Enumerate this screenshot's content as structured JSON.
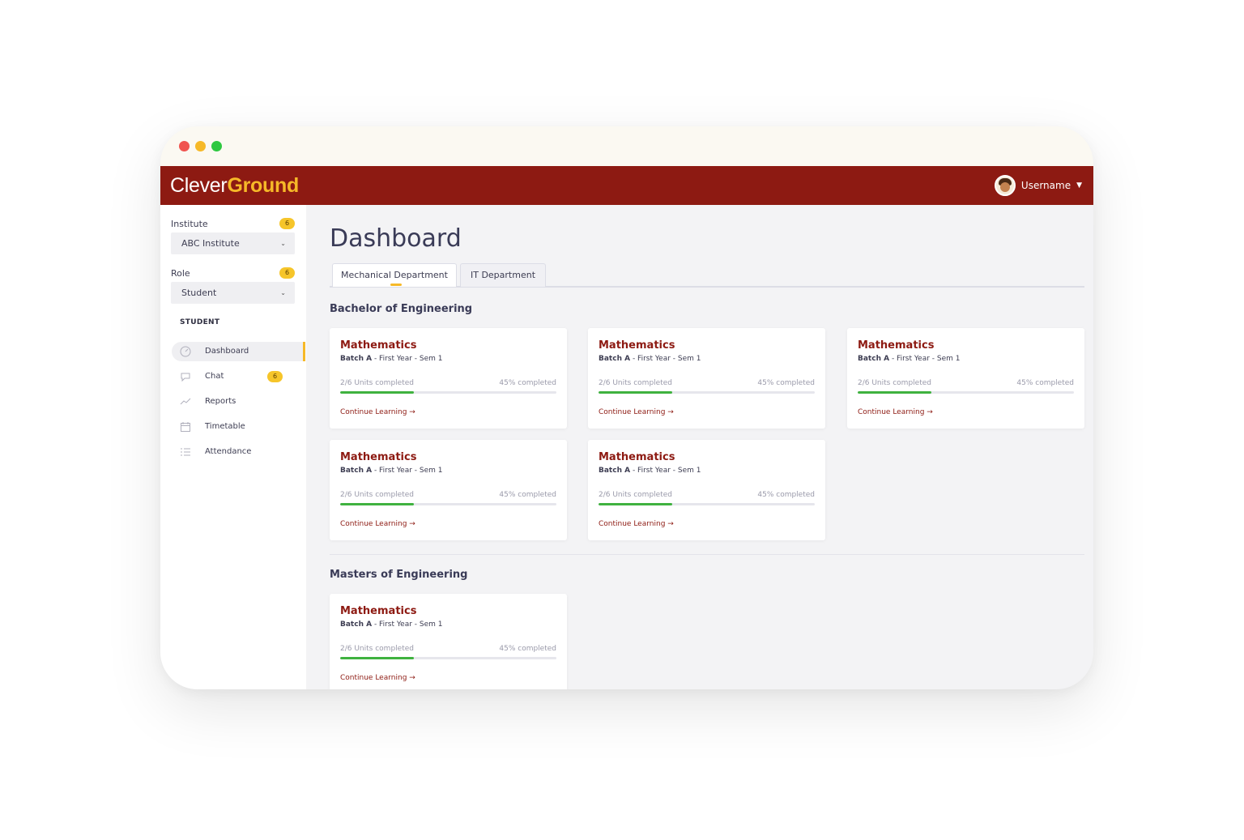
{
  "window": {
    "controls": [
      "close",
      "minimize",
      "maximize"
    ]
  },
  "app": {
    "logo_part1": "Clever",
    "logo_part2": "Ground",
    "username": "Username",
    "brand_color": "#8d1a12",
    "accent_color": "#f6b928"
  },
  "sidebar": {
    "institute": {
      "label": "Institute",
      "badge": "6",
      "value": "ABC Institute"
    },
    "role": {
      "label": "Role",
      "badge": "6",
      "value": "Student"
    },
    "section_title": "STUDENT",
    "items": [
      {
        "label": "Dashboard",
        "icon": "gauge-icon",
        "active": true
      },
      {
        "label": "Chat",
        "icon": "chat-bubble-icon",
        "badge": "6"
      },
      {
        "label": "Reports",
        "icon": "trend-line-icon"
      },
      {
        "label": "Timetable",
        "icon": "calendar-icon"
      },
      {
        "label": "Attendance",
        "icon": "list-icon"
      }
    ]
  },
  "main": {
    "title": "Dashboard",
    "tabs": [
      {
        "label": "Mechanical Department",
        "active": true
      },
      {
        "label": "IT Department",
        "active": false
      }
    ],
    "groups": [
      {
        "title": "Bachelor of Engineering",
        "cards": [
          {
            "title": "Mathematics",
            "batch": "Batch A",
            "term": " - First Year - Sem 1",
            "units": "2/6 Units completed",
            "percent_text": "45% completed",
            "progress": 0.34,
            "link": "Continue Learning"
          },
          {
            "title": "Mathematics",
            "batch": "Batch A",
            "term": " - First Year - Sem 1",
            "units": "2/6 Units completed",
            "percent_text": "45% completed",
            "progress": 0.34,
            "link": "Continue Learning"
          },
          {
            "title": "Mathematics",
            "batch": "Batch A",
            "term": " - First Year - Sem 1",
            "units": "2/6 Units completed",
            "percent_text": "45% completed",
            "progress": 0.34,
            "link": "Continue Learning"
          },
          {
            "title": "Mathematics",
            "batch": "Batch A",
            "term": " - First Year - Sem 1",
            "units": "2/6 Units completed",
            "percent_text": "45% completed",
            "progress": 0.34,
            "link": "Continue Learning"
          },
          {
            "title": "Mathematics",
            "batch": "Batch A",
            "term": " - First Year - Sem 1",
            "units": "2/6 Units completed",
            "percent_text": "45% completed",
            "progress": 0.34,
            "link": "Continue Learning"
          }
        ]
      },
      {
        "title": "Masters of Engineering",
        "cards": [
          {
            "title": "Mathematics",
            "batch": "Batch A",
            "term": " - First Year - Sem 1",
            "units": "2/6 Units completed",
            "percent_text": "45% completed",
            "progress": 0.34,
            "link": "Continue Learning"
          }
        ]
      }
    ]
  }
}
